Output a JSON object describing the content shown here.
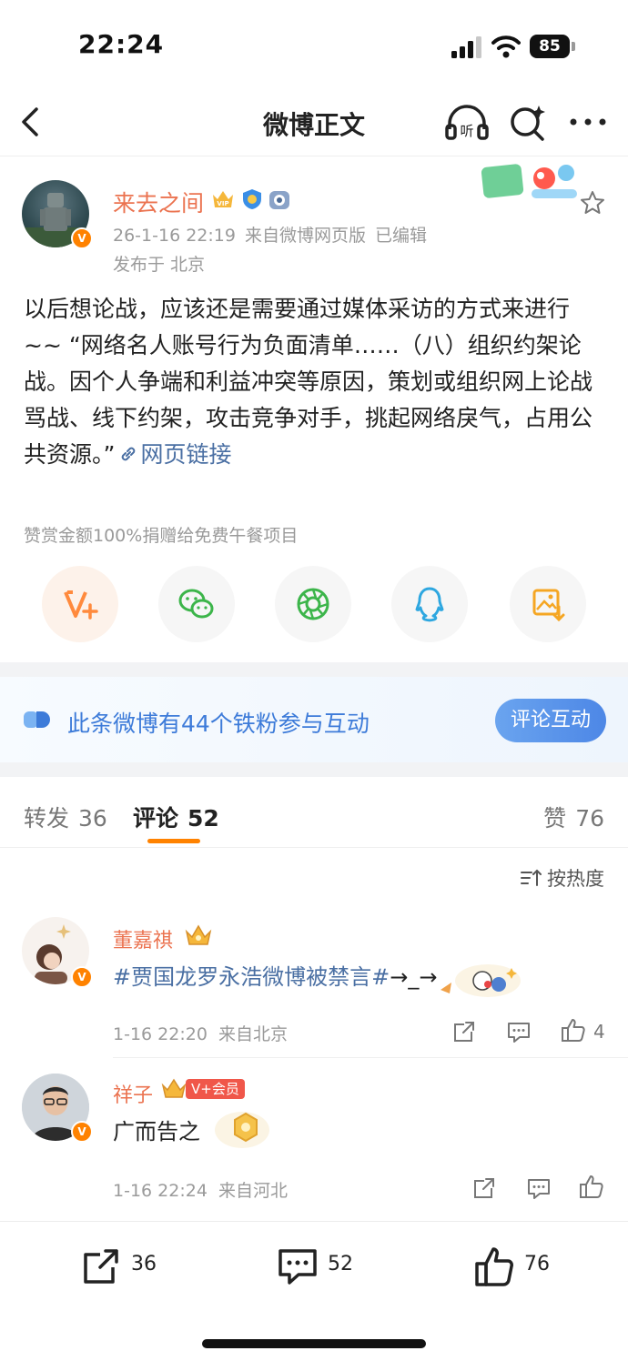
{
  "status_bar": {
    "time": "22:24",
    "battery": "85"
  },
  "nav": {
    "title": "微博正文"
  },
  "post": {
    "author": "来去之间",
    "time": "26-1-16 22:19",
    "source": "来自微博网页版",
    "edited": "已编辑",
    "location": "发布于 北京",
    "body": "以后想论战，应该还是需要通过媒体采访的方式来进行 ~~ “网络名人账号行为负面清单……（八）组织约架论战。因个人争端和利益冲突等原因，策划或组织网上论战骂战、线下约架，攻击竞争对手，挑起网络戾气，占用公共资源。”",
    "link_label": "网页链接"
  },
  "reward": {
    "text": "赞赏金额100%捐赠给免费午餐项目"
  },
  "share_icons": [
    "reward-v-icon",
    "wechat-icon",
    "moments-icon",
    "qq-icon",
    "save-image-icon"
  ],
  "fans_banner": {
    "text": "此条微博有44个铁粉参与互动",
    "button": "评论互动"
  },
  "tabs": {
    "repost_label": "转发",
    "repost_count": "36",
    "comment_label": "评论",
    "comment_count": "52",
    "like_label": "赞",
    "like_count": "76"
  },
  "sort": {
    "label": "按热度"
  },
  "comments": [
    {
      "name": "董嘉祺",
      "text_hashtag": "#贾国龙罗永浩微博被禁言#",
      "text_rest": "→_→",
      "time": "1-16 22:20",
      "source": "来自北京",
      "likes": "4"
    },
    {
      "name": "祥子",
      "member_badge": "V+会员",
      "text": "广而告之",
      "time": "1-16 22:24",
      "source": "来自河北",
      "likes": ""
    }
  ],
  "toolbar": {
    "repost_count": "36",
    "comment_count": "52",
    "like_count": "76"
  },
  "colors": {
    "accent": "#ff8200",
    "name": "#eb7350",
    "link": "#4a6fa3",
    "banner_text": "#3d7bd9"
  }
}
